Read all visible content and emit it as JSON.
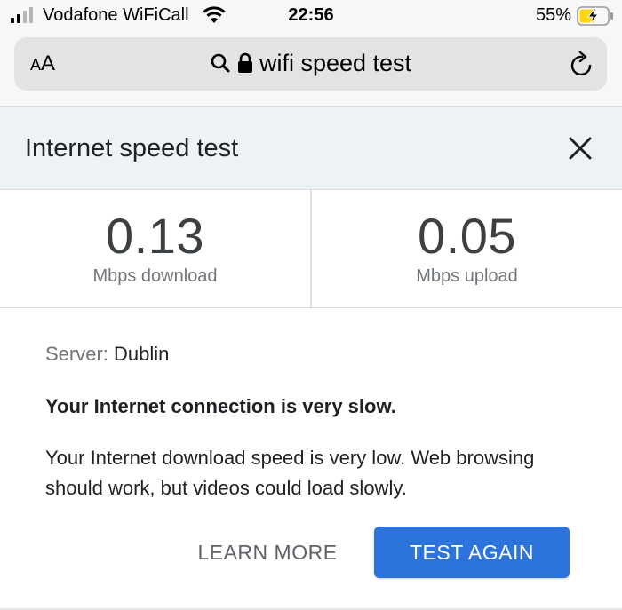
{
  "status_bar": {
    "carrier": "Vodafone WiFiCall",
    "time": "22:56",
    "battery": "55%",
    "icons": [
      "signal-icon",
      "wifi-icon",
      "battery-charging-icon"
    ]
  },
  "browser": {
    "text_size_small": "A",
    "text_size_large": "A",
    "url_text": "wifi speed test",
    "icons": [
      "search-icon",
      "lock-icon",
      "reload-icon"
    ]
  },
  "card": {
    "title": "Internet speed test",
    "close_icon": "close-icon",
    "download": {
      "value": "0.13",
      "unit": "Mbps download"
    },
    "upload": {
      "value": "0.05",
      "unit": "Mbps upload"
    },
    "server_label": "Server:",
    "server_value": "Dublin",
    "headline": "Your Internet connection is very slow.",
    "description": "Your Internet download speed is very low. Web browsing should work, but videos could load slowly.",
    "learn_more": "LEARN MORE",
    "test_again": "TEST AGAIN"
  },
  "colors": {
    "accent": "#2c73db",
    "header_bg": "#edf2f4",
    "url_bar_bg": "#e3e3e5",
    "battery_charging": "#ffd60a"
  }
}
